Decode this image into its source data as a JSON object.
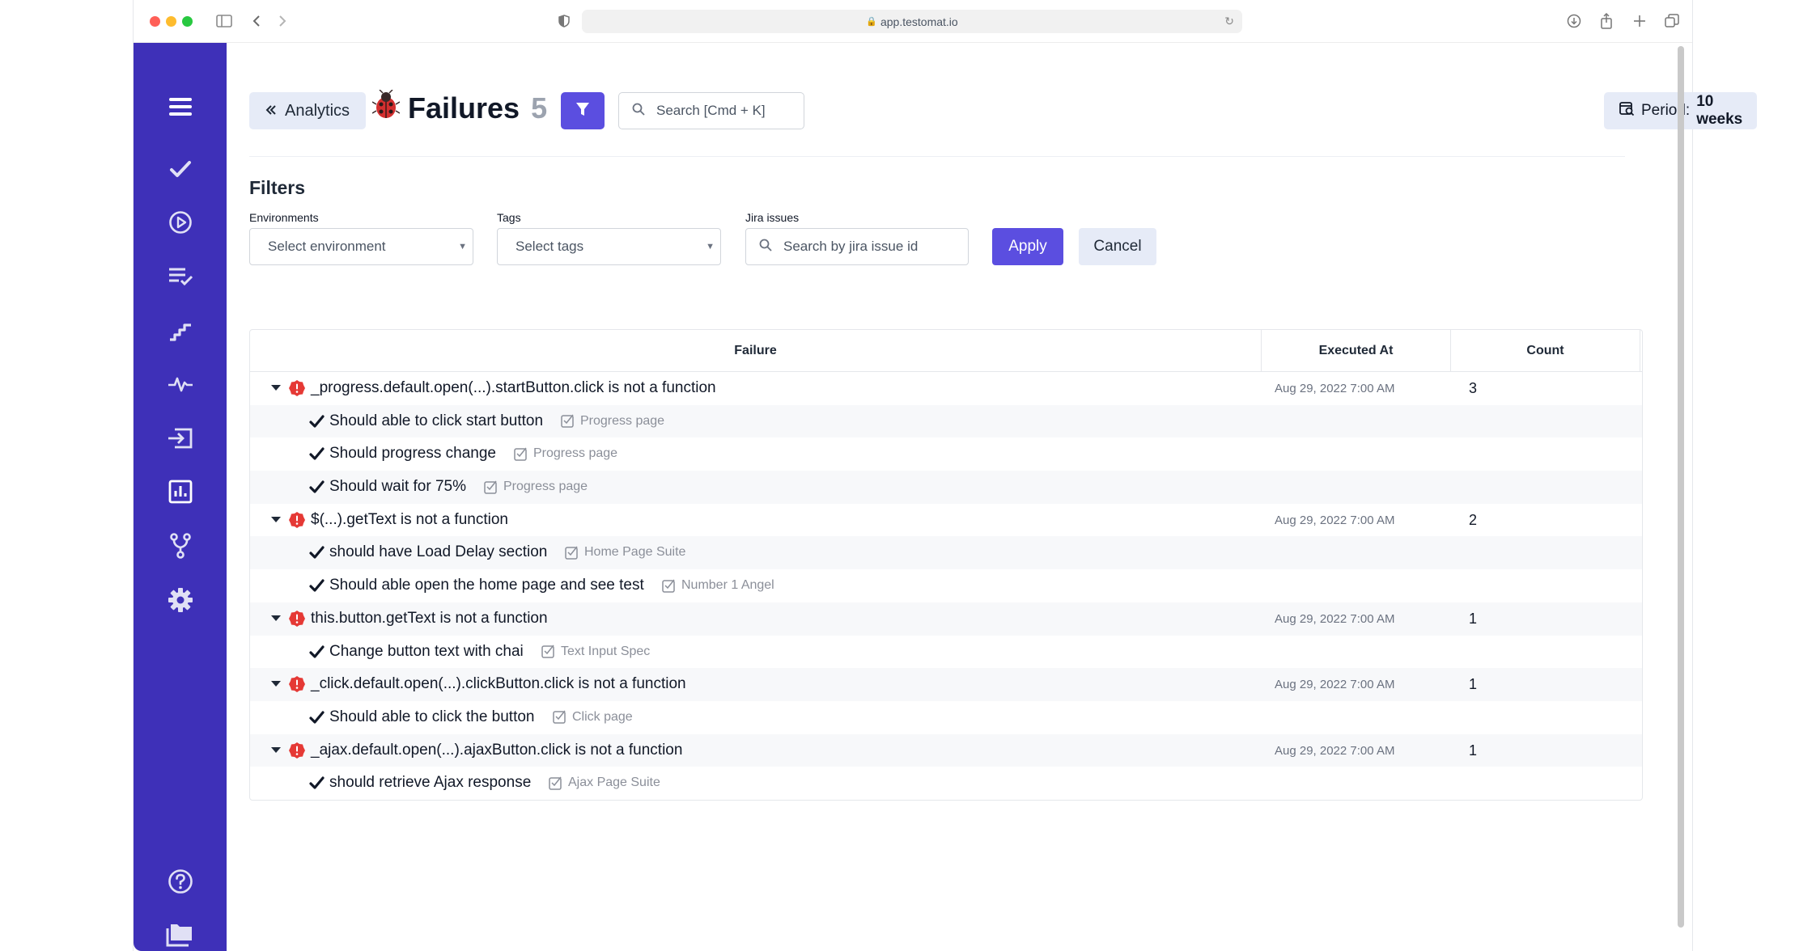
{
  "browser": {
    "url": "app.testomat.io"
  },
  "header": {
    "back_label": "Analytics",
    "title": "Failures",
    "title_count": "5",
    "search_placeholder": "Search [Cmd + K]",
    "period_label": "Period:",
    "period_value": "10 weeks"
  },
  "filters": {
    "title": "Filters",
    "environments_label": "Environments",
    "environments_placeholder": "Select environment",
    "tags_label": "Tags",
    "tags_placeholder": "Select tags",
    "jira_label": "Jira issues",
    "jira_placeholder": "Search by jira issue id",
    "apply_label": "Apply",
    "cancel_label": "Cancel"
  },
  "table": {
    "columns": [
      "Failure",
      "Executed At",
      "Count"
    ],
    "groups": [
      {
        "failure": "_progress.default.open(...).startButton.click is not a function",
        "executed_at": "Aug 29, 2022 7:00 AM",
        "count": "3",
        "tests": [
          {
            "name": "Should able to click start button",
            "suite": "Progress page"
          },
          {
            "name": "Should progress change",
            "suite": "Progress page"
          },
          {
            "name": "Should wait for 75%",
            "suite": "Progress page"
          }
        ]
      },
      {
        "failure": "$(...).getText is not a function",
        "executed_at": "Aug 29, 2022 7:00 AM",
        "count": "2",
        "tests": [
          {
            "name": "should have Load Delay section",
            "suite": "Home Page Suite"
          },
          {
            "name": "Should able open the home page and see test",
            "suite": "Number 1 Angel"
          }
        ]
      },
      {
        "failure": "this.button.getText is not a function",
        "executed_at": "Aug 29, 2022 7:00 AM",
        "count": "1",
        "tests": [
          {
            "name": "Change button text with chai",
            "suite": "Text Input Spec"
          }
        ]
      },
      {
        "failure": "_click.default.open(...).clickButton.click is not a function",
        "executed_at": "Aug 29, 2022 7:00 AM",
        "count": "1",
        "tests": [
          {
            "name": "Should able to click the button",
            "suite": "Click page"
          }
        ]
      },
      {
        "failure": "_ajax.default.open(...).ajaxButton.click is not a function",
        "executed_at": "Aug 29, 2022 7:00 AM",
        "count": "1",
        "tests": [
          {
            "name": "should retrieve Ajax response",
            "suite": "Ajax Page Suite"
          }
        ]
      }
    ]
  },
  "colors": {
    "sidebar": "#3e30b8",
    "primary": "#5b4ee0",
    "soft_button": "#e6ebf7",
    "error": "#e53935"
  },
  "sidebar_icons": [
    "menu-icon",
    "checkmark-icon",
    "play-circle-icon",
    "checklist-icon",
    "steps-icon",
    "pulse-icon",
    "import-icon",
    "analytics-icon",
    "branch-icon",
    "settings-icon",
    "help-icon",
    "folder-icon"
  ]
}
